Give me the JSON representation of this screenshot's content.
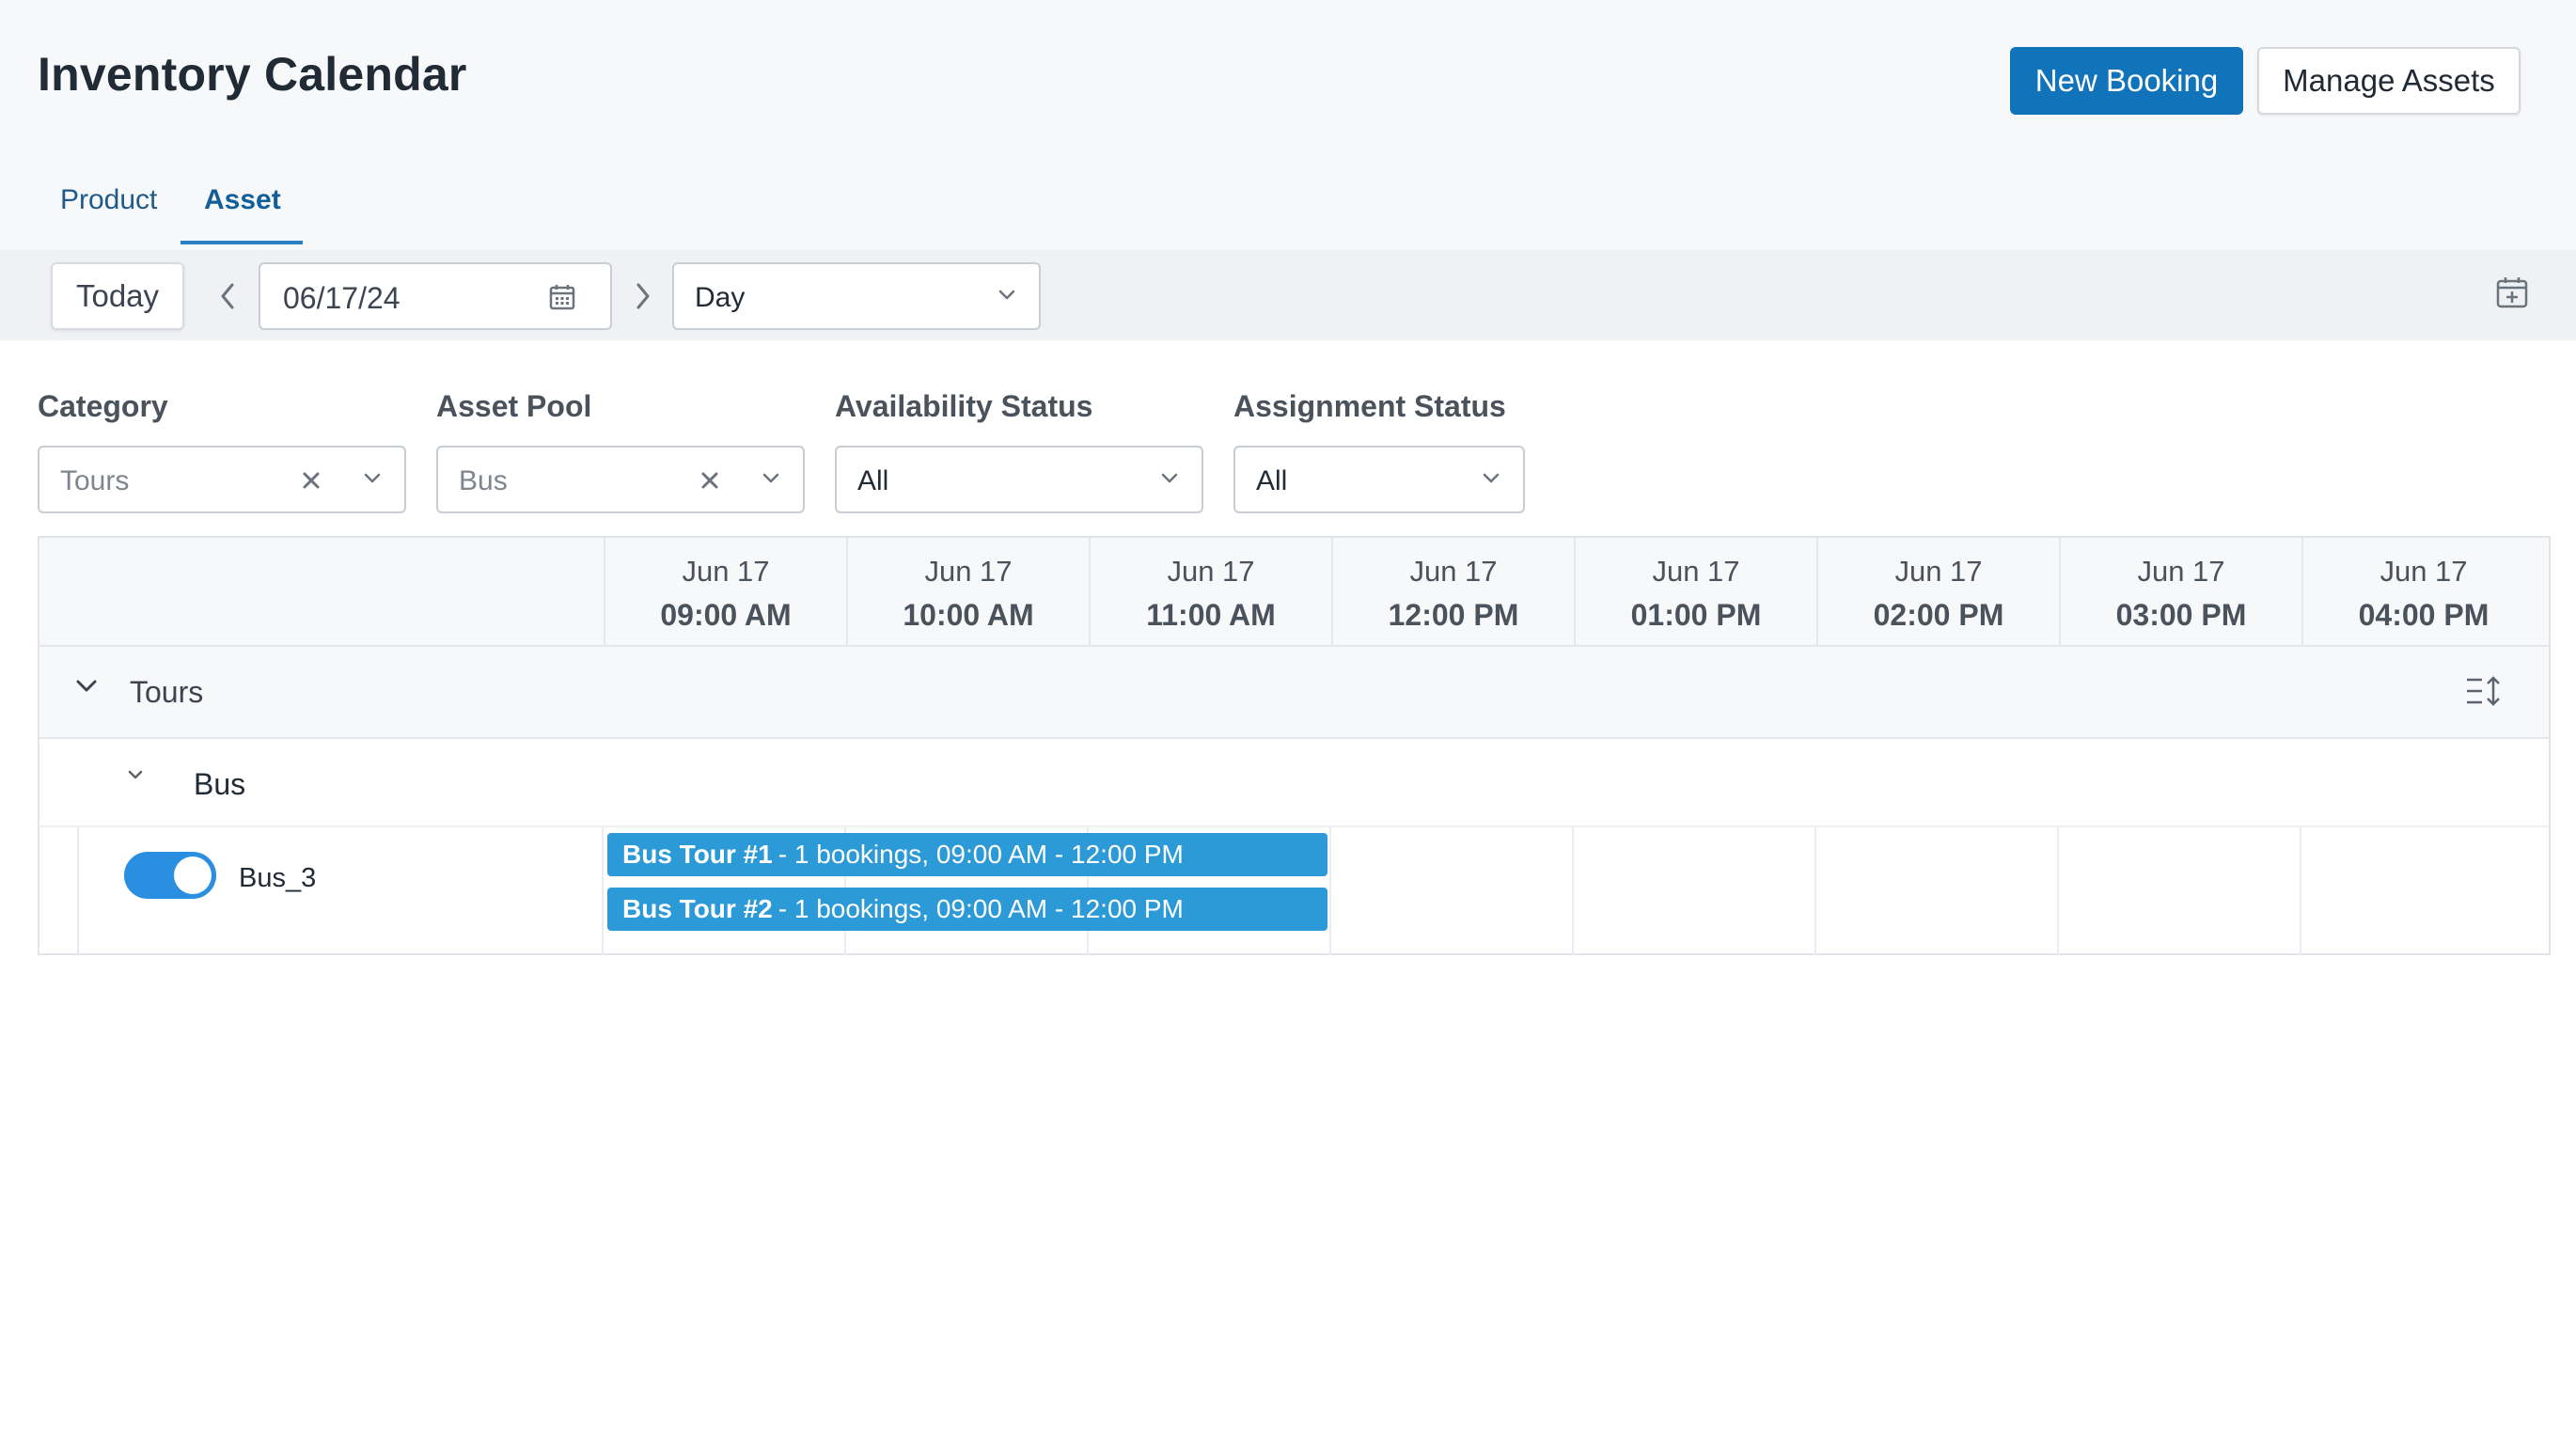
{
  "header": {
    "title": "Inventory Calendar",
    "new_booking_label": "New Booking",
    "manage_assets_label": "Manage Assets"
  },
  "tabs": [
    {
      "label": "Product",
      "active": false
    },
    {
      "label": "Asset",
      "active": true
    }
  ],
  "toolbar": {
    "today_label": "Today",
    "date_value": "06/17/24",
    "view_value": "Day"
  },
  "filters": {
    "category": {
      "label": "Category",
      "value": "Tours"
    },
    "asset_pool": {
      "label": "Asset Pool",
      "value": "Bus"
    },
    "availability": {
      "label": "Availability Status",
      "value": "All"
    },
    "assignment": {
      "label": "Assignment Status",
      "value": "All"
    }
  },
  "columns": [
    {
      "date": "Jun 17",
      "time": "09:00 AM"
    },
    {
      "date": "Jun 17",
      "time": "10:00 AM"
    },
    {
      "date": "Jun 17",
      "time": "11:00 AM"
    },
    {
      "date": "Jun 17",
      "time": "12:00 PM"
    },
    {
      "date": "Jun 17",
      "time": "01:00 PM"
    },
    {
      "date": "Jun 17",
      "time": "02:00 PM"
    },
    {
      "date": "Jun 17",
      "time": "03:00 PM"
    },
    {
      "date": "Jun 17",
      "time": "04:00 PM"
    }
  ],
  "groups": {
    "category": "Tours",
    "pool": "Bus",
    "asset": {
      "name": "Bus_3",
      "enabled": true
    }
  },
  "bookings": [
    {
      "name": "Bus Tour #1",
      "detail": "- 1 bookings, 09:00 AM - 12:00 PM"
    },
    {
      "name": "Bus Tour #2",
      "detail": "- 1 bookings, 09:00 AM - 12:00 PM"
    }
  ],
  "colors": {
    "primary": "#1173b9",
    "booking": "#2d9ad8",
    "toggle_on": "#2a8fe0"
  }
}
